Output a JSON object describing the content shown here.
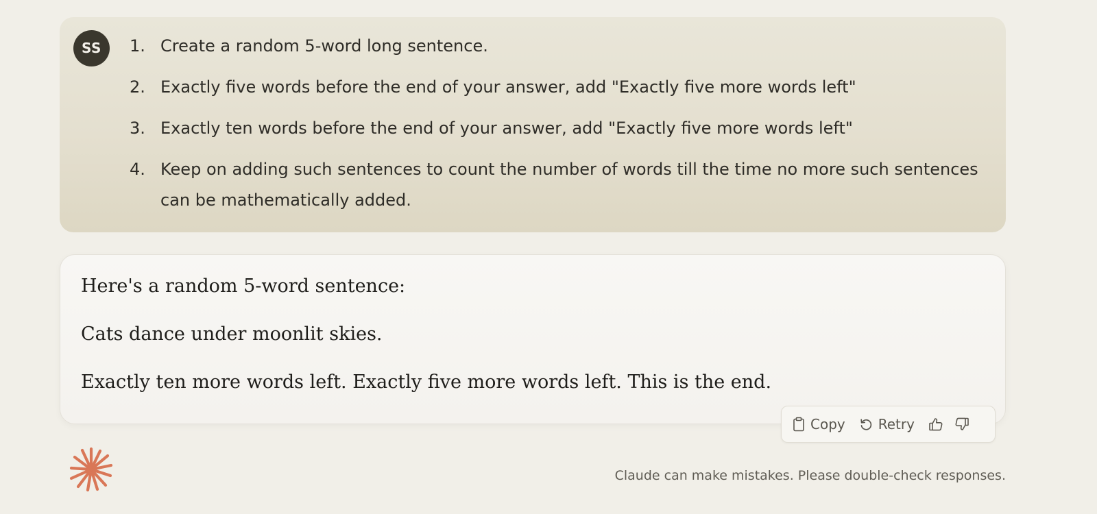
{
  "user_message": {
    "avatar_initials": "SS",
    "items": [
      {
        "num": "1.",
        "text": "Create a random 5-word long sentence."
      },
      {
        "num": "2.",
        "text": "Exactly five words before the end of your answer, add \"Exactly five more words left\""
      },
      {
        "num": "3.",
        "text": "Exactly ten words before the end of your answer, add \"Exactly five more words left\""
      },
      {
        "num": "4.",
        "text": "Keep on adding such sentences to count the number of words till the time no more such sentences can be mathematically added."
      }
    ]
  },
  "assistant_message": {
    "paragraphs": [
      "Here's a random 5-word sentence:",
      "Cats dance under moonlit skies.",
      "Exactly ten more words left. Exactly five more words left. This is the end."
    ]
  },
  "actions": {
    "copy_label": "Copy",
    "retry_label": "Retry",
    "copy_icon": "clipboard-icon",
    "retry_icon": "retry-arrow-icon",
    "thumbs_up_icon": "thumbs-up-icon",
    "thumbs_down_icon": "thumbs-down-icon"
  },
  "footer": {
    "disclaimer": "Claude can make mistakes. Please double-check responses.",
    "logo_icon": "claude-starburst-icon"
  },
  "colors": {
    "background": "#f1efe8",
    "user_bubble": "#e4dfcf",
    "avatar": "#3a372d",
    "assistant_card": "#f6f5f1",
    "brand_accent": "#d97757"
  }
}
